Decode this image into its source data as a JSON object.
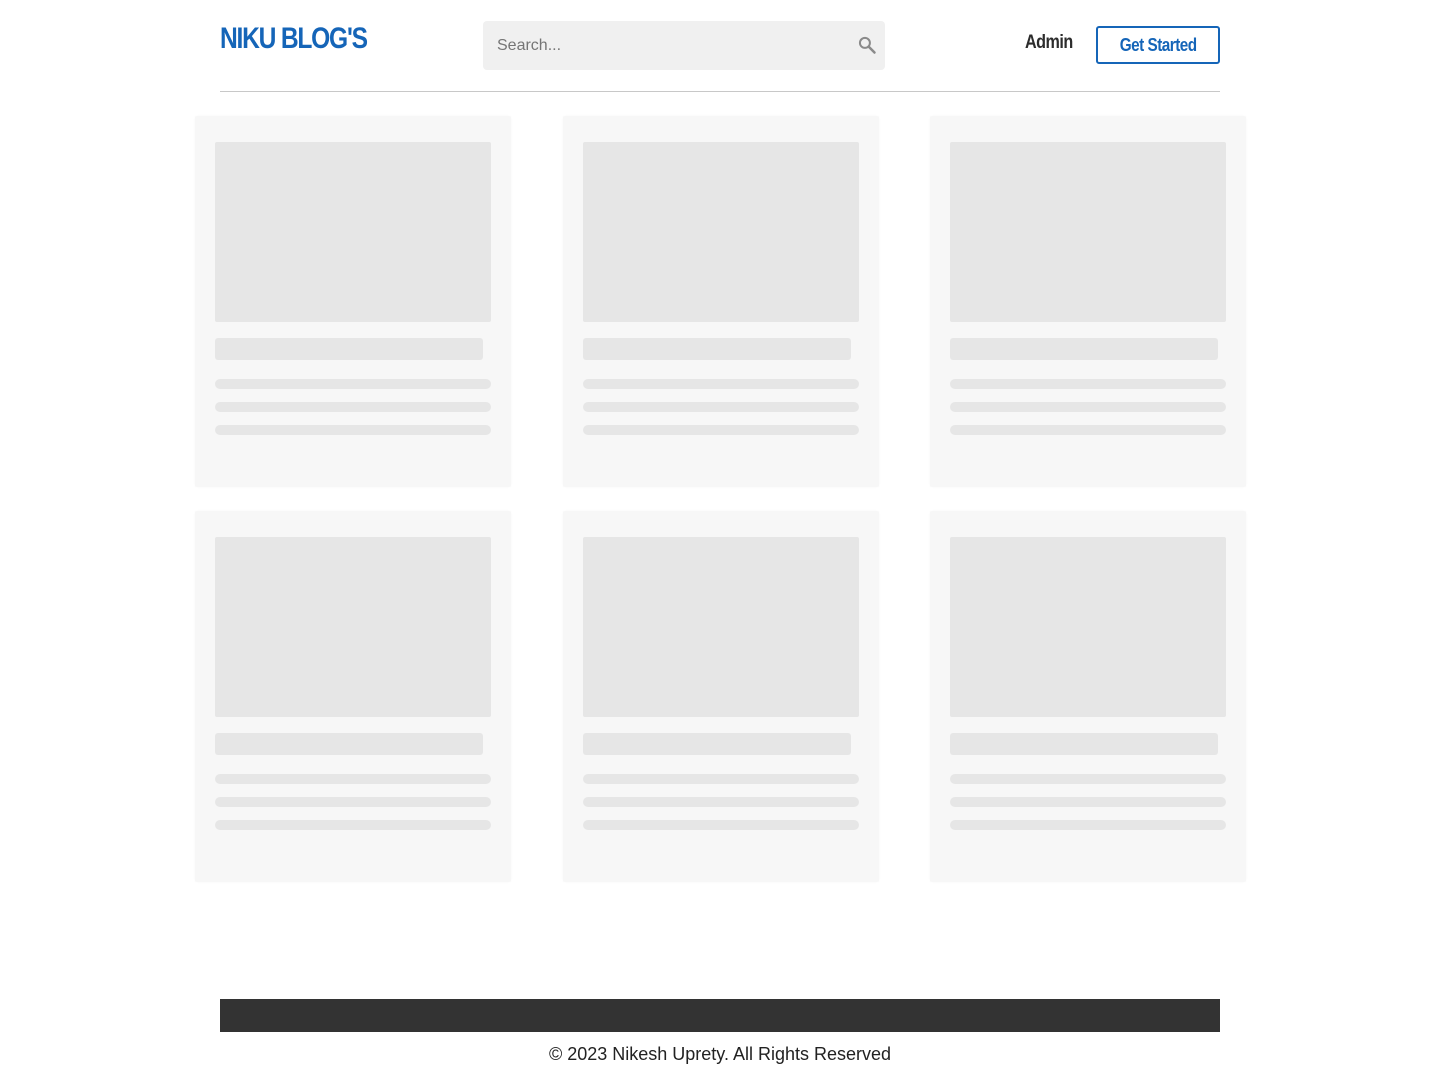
{
  "header": {
    "logo": "NIKU BLOG'S",
    "search_placeholder": "Search...",
    "search_icon": "search-icon",
    "admin_label": "Admin",
    "cta_label": "Get Started"
  },
  "colors": {
    "brand": "#1565b8",
    "skeleton": "#e6e6e6",
    "card_bg": "#f7f7f7",
    "footer_bar": "#333333"
  },
  "posts": {
    "state": "loading",
    "placeholder_cards": 6
  },
  "footer": {
    "copyright": "© 2023 Nikesh Uprety. All Rights Reserved"
  }
}
